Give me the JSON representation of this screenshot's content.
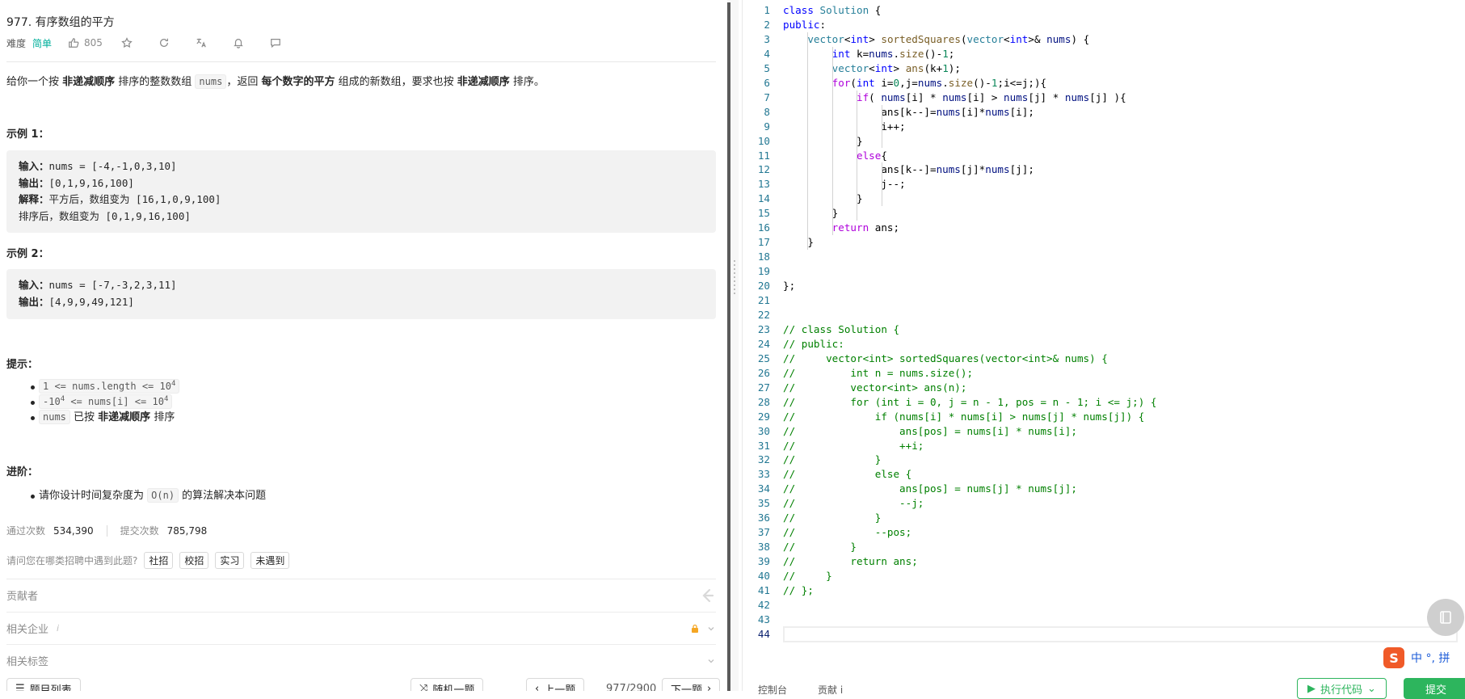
{
  "problem": {
    "title": "977. 有序数组的平方",
    "difficulty_label": "难度",
    "difficulty": "简单",
    "likes": "805"
  },
  "description": {
    "p1": "给你一个按 ",
    "b1": "非递减顺序",
    "p2": " 排序的整数数组 ",
    "code1": "nums",
    "p3": "，返回 ",
    "b2": "每个数字的平方",
    "p4": " 组成的新数组，要求也按 ",
    "b3": "非递减顺序",
    "p5": " 排序。"
  },
  "examples": [
    {
      "title": "示例 1：",
      "input_label": "输入：",
      "input": "nums = [-4,-1,0,3,10]",
      "output_label": "输出：",
      "output": "[0,1,9,16,100]",
      "explain_label": "解释：",
      "explain1": "平方后，数组变为 [16,1,0,9,100]",
      "explain2": "排序后，数组变为 [0,1,9,16,100]"
    },
    {
      "title": "示例 2：",
      "input_label": "输入：",
      "input": "nums = [-7,-3,2,3,11]",
      "output_label": "输出：",
      "output": "[4,9,9,49,121]"
    }
  ],
  "hints": {
    "title": "提示：",
    "h1_a": "1 <= nums.length <= 10",
    "h1_sup": "4",
    "h2_a": "-10",
    "h2_sup1": "4",
    "h2_b": " <= nums[i] <= 10",
    "h2_sup2": "4",
    "h3_code": "nums",
    "h3_a": " 已按 ",
    "h3_b": "非递减顺序",
    "h3_c": " 排序"
  },
  "advanced": {
    "title": "进阶：",
    "a1": "请你设计时间复杂度为 ",
    "code": "O(n)",
    "a2": " 的算法解决本问题"
  },
  "stats": {
    "pass_label": "通过次数",
    "pass": "534,390",
    "submit_label": "提交次数",
    "submit": "785,798"
  },
  "survey": {
    "question": "请问您在哪类招聘中遇到此题?",
    "tags": [
      "社招",
      "校招",
      "实习",
      "未遇到"
    ]
  },
  "sections": {
    "contributors": "贡献者",
    "companies": "相关企业",
    "companies_info": "i",
    "tags": "相关标签"
  },
  "bottom": {
    "list": "题目列表",
    "random": "随机一题",
    "prev": "上一题",
    "pager": "977/2900",
    "next": "下一题"
  },
  "editor": {
    "current_line": 44,
    "code_lines": [
      "class Solution {",
      "public:",
      "    vector<int> sortedSquares(vector<int>& nums) {",
      "        int k=nums.size()-1;",
      "        vector<int> ans(k+1);",
      "        for(int i=0,j=nums.size()-1;i<=j;){",
      "            if( nums[i] * nums[i] > nums[j] * nums[j] ){",
      "                ans[k--]=nums[i]*nums[i];",
      "                i++;",
      "            }",
      "            else{",
      "                ans[k--]=nums[j]*nums[j];",
      "                j--;",
      "            }",
      "        }",
      "        return ans;",
      "    }",
      "",
      "",
      "};",
      "",
      "",
      "// class Solution {",
      "// public:",
      "//     vector<int> sortedSquares(vector<int>& nums) {",
      "//         int n = nums.size();",
      "//         vector<int> ans(n);",
      "//         for (int i = 0, j = n - 1, pos = n - 1; i <= j;) {",
      "//             if (nums[i] * nums[i] > nums[j] * nums[j]) {",
      "//                 ans[pos] = nums[i] * nums[i];",
      "//                 ++i;",
      "//             }",
      "//             else {",
      "//                 ans[pos] = nums[j] * nums[j];",
      "//                 --j;",
      "//             }",
      "//             --pos;",
      "//         }",
      "//         return ans;",
      "//     }",
      "// };",
      "",
      "",
      ""
    ]
  },
  "editor_bottom": {
    "console": "控制台",
    "contribute": "贡献 i",
    "run": "执行代码",
    "submit": "提交"
  },
  "ime": {
    "logo": "S",
    "text": "中 °, 拼"
  }
}
